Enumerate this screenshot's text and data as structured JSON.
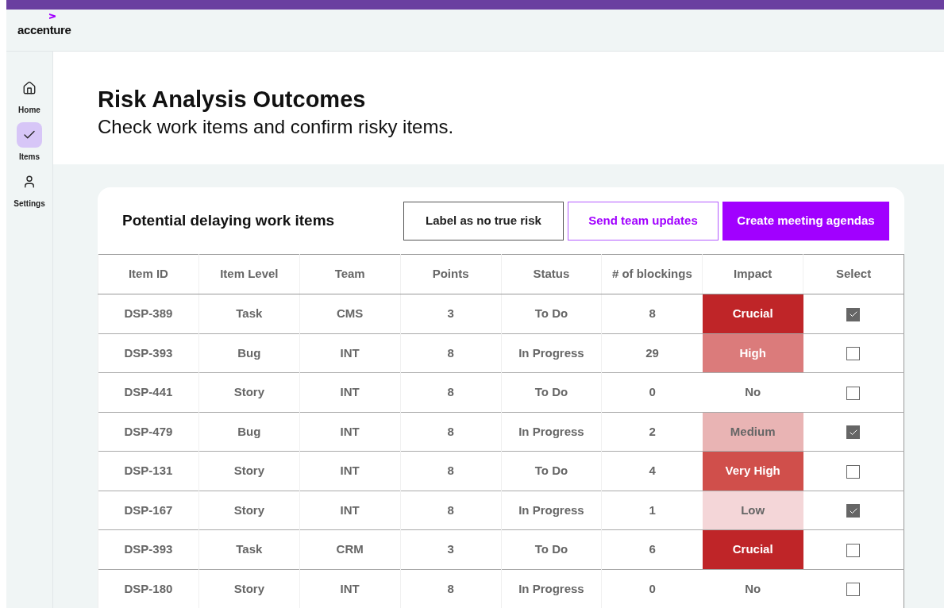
{
  "header": {
    "logo": "accenture"
  },
  "sidebar": {
    "items": [
      {
        "label": "Home",
        "kind": "home",
        "selected": false
      },
      {
        "label": "Items",
        "kind": "check",
        "selected": true
      },
      {
        "label": "Settings",
        "kind": "user",
        "selected": false
      }
    ]
  },
  "page": {
    "title": "Risk Analysis Outcomes",
    "subtitle": "Check work items and confirm risky items."
  },
  "card": {
    "title": "Potential delaying work items",
    "buttons": [
      {
        "label": "Label as no true risk",
        "kind": "outline"
      },
      {
        "label": "Send team updates",
        "kind": "accent-outline"
      },
      {
        "label": "Create meeting agendas",
        "kind": "primary"
      }
    ]
  },
  "table": {
    "columns": [
      "Item ID",
      "Item Level",
      "Team",
      "Points",
      "Status",
      "# of blockings",
      "Impact",
      "Select"
    ],
    "rows": [
      {
        "id": "DSP-389",
        "level_name": "Task",
        "team": "CMS",
        "points": "3",
        "status": "To Do",
        "blockings": "8",
        "impact": "Crucial",
        "color": "#bf2528",
        "checked": true
      },
      {
        "id": "DSP-393",
        "level_name": "Bug",
        "team": "INT",
        "points": "8",
        "status": "In Progress",
        "blockings": "29",
        "impact": "High",
        "color": "#db7b7b",
        "checked": false
      },
      {
        "id": "DSP-441",
        "level_name": "Story",
        "team": "INT",
        "points": "8",
        "status": "To Do",
        "blockings": "0",
        "impact": "No",
        "color": "#ffffff",
        "checked": false
      },
      {
        "id": "DSP-479",
        "level_name": "Bug",
        "team": "INT",
        "points": "8",
        "status": "In Progress",
        "blockings": "2",
        "impact": "Medium",
        "color": "#e9b4b4",
        "checked": true
      },
      {
        "id": "DSP-131",
        "level_name": "Story",
        "team": "INT",
        "points": "8",
        "status": "To Do",
        "blockings": "4",
        "impact": "Very High",
        "color": "#d04f4b",
        "checked": false
      },
      {
        "id": "DSP-167",
        "level_name": "Story",
        "team": "INT",
        "points": "8",
        "status": "In Progress",
        "blockings": "1",
        "impact": "Low",
        "color": "#f4d6d8",
        "checked": true
      },
      {
        "id": "DSP-393",
        "level_name": "Task",
        "team": "CRM",
        "points": "3",
        "status": "To Do",
        "blockings": "6",
        "impact": "Crucial",
        "color": "#bf2528",
        "checked": false
      },
      {
        "id": "DSP-180",
        "level_name": "Story",
        "team": "INT",
        "points": "8",
        "status": "In Progress",
        "blockings": "0",
        "impact": "No",
        "color": "#ffffff",
        "checked": false
      }
    ]
  }
}
